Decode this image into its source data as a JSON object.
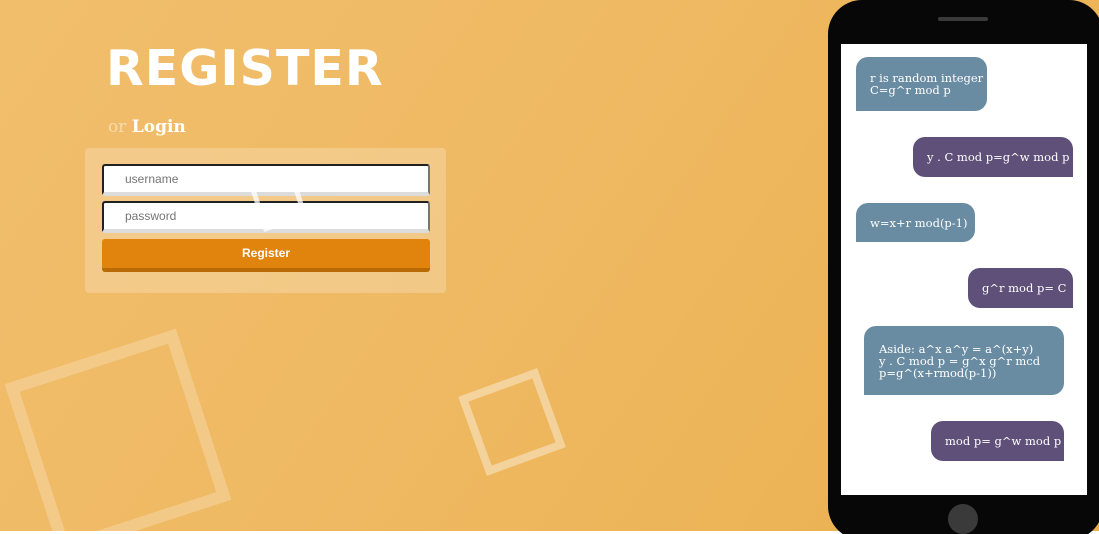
{
  "register": {
    "title": "REGISTER",
    "or_text": "or",
    "login_label": "Login",
    "username_placeholder": "username",
    "password_placeholder": "password",
    "submit_label": "Register"
  },
  "phone": {
    "messages": [
      {
        "side": "left",
        "lines": [
          "r is random integer",
          "C=g^r mod p"
        ]
      },
      {
        "side": "right",
        "lines": [
          "y . C mod p=g^w mod p"
        ]
      },
      {
        "side": "left",
        "lines": [
          "w=x+r mod(p-1)"
        ]
      },
      {
        "side": "right",
        "lines": [
          "g^r mod p= C"
        ]
      },
      {
        "side": "left",
        "lines": [
          "Aside: a^x a^y = a^(x+y)",
          "y . C mod p = g^x g^r mcd",
          "p=g^(x+rmod(p-1))"
        ]
      },
      {
        "side": "right",
        "lines": [
          "mod p= g^w mod p"
        ]
      }
    ]
  },
  "colors": {
    "background_gradient": [
      "#f1be6c",
      "#ebb04e"
    ],
    "button": "#e0840e",
    "bubble_left": "#6a8ca3",
    "bubble_right": "#5f5079",
    "phone_body": "#070707"
  }
}
